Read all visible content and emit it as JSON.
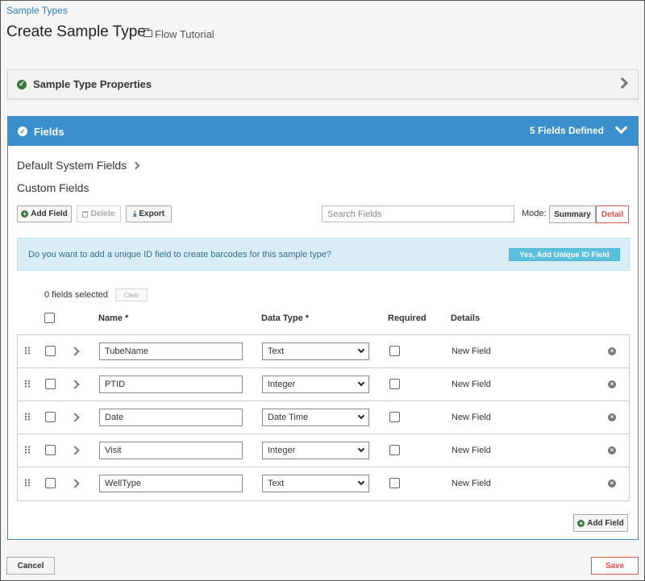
{
  "breadcrumb": "Sample Types",
  "page_title": "Create Sample Type",
  "project": "Flow Tutorial",
  "props_panel": {
    "title": "Sample Type Properties"
  },
  "fields_panel": {
    "title": "Fields",
    "count_text": "5 Fields Defined",
    "system_fields_label": "Default System Fields",
    "custom_fields_label": "Custom Fields",
    "toolbar": {
      "add_field": "Add Field",
      "delete": "Delete",
      "export": "Export"
    },
    "search": {
      "placeholder": "Search Fields"
    },
    "mode": {
      "label": "Mode:",
      "summary": "Summary",
      "detail": "Detail"
    },
    "alert": {
      "message": "Do you want to add a unique ID field to create barcodes for this sample type?",
      "button": "Yes, Add Unique ID Field"
    },
    "selection": {
      "count_text": "0 fields selected",
      "clear": "Clear"
    },
    "columns": {
      "name": "Name *",
      "data_type": "Data Type *",
      "required": "Required",
      "details": "Details"
    },
    "rows": [
      {
        "name": "TubeName",
        "type": "Text",
        "details": "New Field"
      },
      {
        "name": "PTID",
        "type": "Integer",
        "details": "New Field"
      },
      {
        "name": "Date",
        "type": "Date Time",
        "details": "New Field"
      },
      {
        "name": "Visit",
        "type": "Integer",
        "details": "New Field"
      },
      {
        "name": "WellType",
        "type": "Text",
        "details": "New Field"
      }
    ],
    "add_field_bottom": "Add Field"
  },
  "footer": {
    "cancel": "Cancel",
    "save": "Save"
  },
  "colors": {
    "primary": "#3a8fcd",
    "success": "#3c763d",
    "danger": "#d9534f",
    "info_bg": "#d9edf7",
    "info_button": "#5bc0de"
  }
}
